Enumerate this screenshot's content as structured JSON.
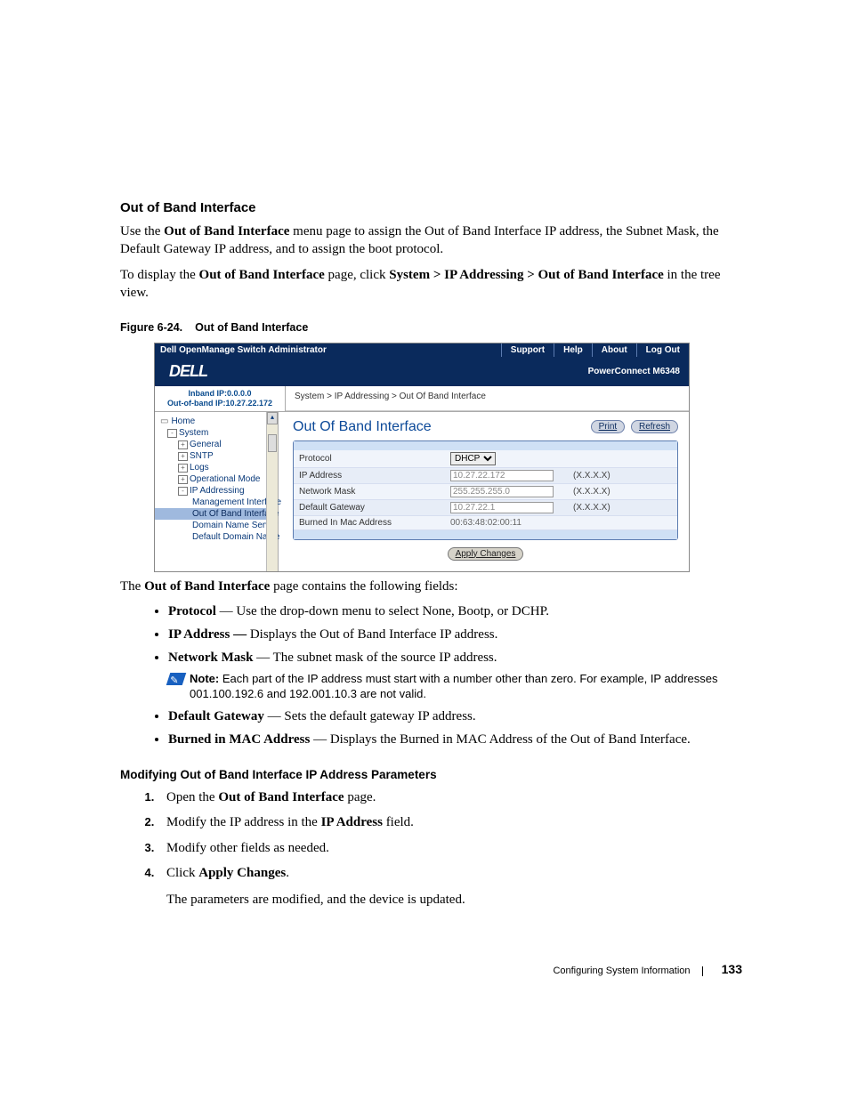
{
  "section": {
    "title": "Out of Band Interface"
  },
  "intro": {
    "p1a": "Use the ",
    "p1b": "Out of Band Interface",
    "p1c": " menu page to assign the Out of Band Interface IP address, the Subnet Mask, the Default Gateway IP address, and to assign the boot protocol.",
    "p2a": "To display the ",
    "p2b": "Out of Band Interface",
    "p2c": " page, click ",
    "p2d": "System > IP Addressing > Out of Band Interface",
    "p2e": " in the tree view."
  },
  "figure": {
    "num": "Figure 6-24.",
    "title": "Out of Band Interface"
  },
  "ss": {
    "topbar": {
      "title": "Dell OpenManage Switch Administrator",
      "links": {
        "support": "Support",
        "help": "Help",
        "about": "About",
        "logout": "Log Out"
      }
    },
    "logo": "DELL",
    "product": "PowerConnect M6348",
    "infoleft": {
      "line1": "Inband IP:0.0.0.0",
      "line2": "Out-of-band IP:10.27.22.172"
    },
    "breadcrumb": "System > IP Addressing > Out Of Band Interface",
    "tree": {
      "home": "Home",
      "system": "System",
      "general": "General",
      "sntp": "SNTP",
      "logs": "Logs",
      "opmode": "Operational Mode",
      "ipaddr": "IP Addressing",
      "mgmtif": "Management Interface",
      "oobif": "Out Of Band Interface",
      "dns": "Domain Name Server",
      "ddn": "Default Domain Name"
    },
    "main": {
      "title": "Out Of Band Interface",
      "print": "Print",
      "refresh": "Refresh",
      "rows": {
        "protocol_label": "Protocol",
        "protocol_value": "DHCP",
        "ip_label": "IP Address",
        "ip_value": "10.27.22.172",
        "ip_hint": "(X.X.X.X)",
        "mask_label": "Network Mask",
        "mask_value": "255.255.255.0",
        "mask_hint": "(X.X.X.X)",
        "gw_label": "Default Gateway",
        "gw_value": "10.27.22.1",
        "gw_hint": "(X.X.X.X)",
        "mac_label": "Burned In Mac Address",
        "mac_value": "00:63:48:02:00:11"
      },
      "apply": "Apply Changes"
    }
  },
  "afterfig": {
    "lead_a": "The ",
    "lead_b": "Out of Band Interface",
    "lead_c": " page contains the following fields:"
  },
  "fields": {
    "protocol": {
      "name": "Protocol",
      "sep": " — ",
      "desc": "Use the drop-down menu to select None, Bootp, or DCHP."
    },
    "ip": {
      "name": "IP Address —",
      "sep": " ",
      "desc": "Displays the Out of Band Interface IP address."
    },
    "mask": {
      "name": "Network Mask",
      "sep": " — ",
      "desc": "The subnet mask of the source IP address."
    },
    "gw": {
      "name": "Default Gateway",
      "sep": " — ",
      "desc": "Sets the default gateway IP address."
    },
    "mac": {
      "name": "Burned in MAC Address",
      "sep": " — ",
      "desc": "Displays the Burned in MAC Address of the Out of Band Interface."
    }
  },
  "note": {
    "label": "Note:",
    "text": " Each part of the IP address must start with a number other than zero. For example, IP addresses 001.100.192.6 and 192.001.10.3 are not valid."
  },
  "subheading": "Modifying Out of Band Interface IP Address Parameters",
  "steps": {
    "s1a": "Open the ",
    "s1b": "Out of Band Interface",
    "s1c": " page.",
    "s2a": "Modify the IP address in the ",
    "s2b": "IP Address",
    "s2c": " field.",
    "s3": "Modify other fields as needed.",
    "s4a": "Click ",
    "s4b": "Apply Changes",
    "s4c": ".",
    "post": "The parameters are modified, and the device is updated."
  },
  "footer": {
    "chapter": "Configuring System Information",
    "page": "133"
  }
}
